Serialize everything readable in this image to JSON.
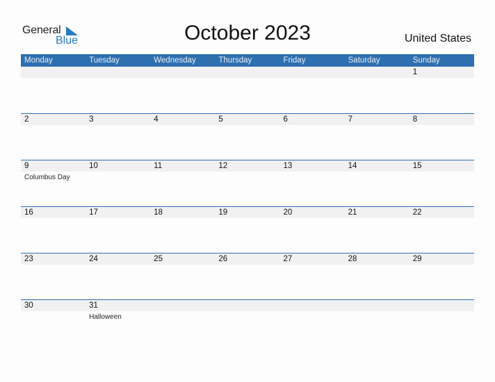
{
  "logo": {
    "word1": "General",
    "word2": "Blue"
  },
  "title": "October 2023",
  "country": "United States",
  "colors": {
    "accent": "#2e6fb0",
    "strip": "#f1f1f1",
    "logo_blue": "#2a7bc0"
  },
  "weekdays": [
    "Monday",
    "Tuesday",
    "Wednesday",
    "Thursday",
    "Friday",
    "Saturday",
    "Sunday"
  ],
  "weeks": [
    {
      "days": [
        {
          "num": "",
          "event": ""
        },
        {
          "num": "",
          "event": ""
        },
        {
          "num": "",
          "event": ""
        },
        {
          "num": "",
          "event": ""
        },
        {
          "num": "",
          "event": ""
        },
        {
          "num": "",
          "event": ""
        },
        {
          "num": "1",
          "event": ""
        }
      ]
    },
    {
      "days": [
        {
          "num": "2",
          "event": ""
        },
        {
          "num": "3",
          "event": ""
        },
        {
          "num": "4",
          "event": ""
        },
        {
          "num": "5",
          "event": ""
        },
        {
          "num": "6",
          "event": ""
        },
        {
          "num": "7",
          "event": ""
        },
        {
          "num": "8",
          "event": ""
        }
      ]
    },
    {
      "days": [
        {
          "num": "9",
          "event": "Columbus Day"
        },
        {
          "num": "10",
          "event": ""
        },
        {
          "num": "11",
          "event": ""
        },
        {
          "num": "12",
          "event": ""
        },
        {
          "num": "13",
          "event": ""
        },
        {
          "num": "14",
          "event": ""
        },
        {
          "num": "15",
          "event": ""
        }
      ]
    },
    {
      "days": [
        {
          "num": "16",
          "event": ""
        },
        {
          "num": "17",
          "event": ""
        },
        {
          "num": "18",
          "event": ""
        },
        {
          "num": "19",
          "event": ""
        },
        {
          "num": "20",
          "event": ""
        },
        {
          "num": "21",
          "event": ""
        },
        {
          "num": "22",
          "event": ""
        }
      ]
    },
    {
      "days": [
        {
          "num": "23",
          "event": ""
        },
        {
          "num": "24",
          "event": ""
        },
        {
          "num": "25",
          "event": ""
        },
        {
          "num": "26",
          "event": ""
        },
        {
          "num": "27",
          "event": ""
        },
        {
          "num": "28",
          "event": ""
        },
        {
          "num": "29",
          "event": ""
        }
      ]
    },
    {
      "days": [
        {
          "num": "30",
          "event": ""
        },
        {
          "num": "31",
          "event": "Halloween"
        },
        {
          "num": "",
          "event": ""
        },
        {
          "num": "",
          "event": ""
        },
        {
          "num": "",
          "event": ""
        },
        {
          "num": "",
          "event": ""
        },
        {
          "num": "",
          "event": ""
        }
      ]
    }
  ]
}
